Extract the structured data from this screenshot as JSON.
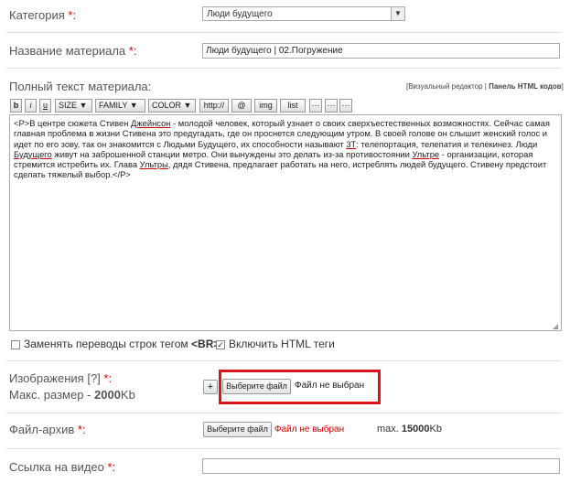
{
  "category": {
    "label": "Категория",
    "required": "*:",
    "value": "Люди будущего"
  },
  "title": {
    "label": "Название материала",
    "required": "*:",
    "value": "Люди будущего | 02.Погружение"
  },
  "fulltext": {
    "label": "Полный текст материала:",
    "editor_modes": {
      "visual": "[Визуальный редактор",
      "sep": " | ",
      "html": "Панель HTML кодов",
      "close": "]"
    },
    "toolbar": {
      "b": "b",
      "i": "i",
      "u": "u",
      "size": "SIZE",
      "family": "FAMILY",
      "color": "COLOR",
      "http": "http://",
      "at": "@",
      "img": "img",
      "list": "list",
      "dots1": "···",
      "dots2": "···",
      "dots3": "···"
    },
    "content": {
      "p1": "<P>В центре сюжета Стивен ",
      "w1": "Джейнсон",
      "p2": " - молодой человек, который узнает о своих сверхъестественных возможностях. Сейчас самая главная проблема в жизни Стивена это предугадать, где он проснется следующим утром. В своей голове он слышит женский голос и идет по его зову, так он знакомится с Людьми Будущего, их способности называют ",
      "w2": "3Т",
      "p3": ": телепортация, телепатия и телекинез. Люди ",
      "w3": "Будущего",
      "p4": " живут на заброшенной станции метро. Они вынуждены это делать из-за противостоянии ",
      "w4": "Ультре",
      "p5": " - организации, которая стремится истребить их. Глава ",
      "w5": "Ультры",
      "p6": ", дядя Стивена, предлагает работать на него, истреблять людей будущего. Стивену предстоит сделать тяжелый выбор.</P>"
    }
  },
  "options": {
    "br_label_pre": "Заменять переводы строк тегом ",
    "br_tag": "<BR>",
    "html_label": "Включить HTML теги"
  },
  "images": {
    "label": "Изображения",
    "help": "[?]",
    "required": "*:",
    "size_pre": "Макс. размер - ",
    "size_val": "2000",
    "size_unit": "Kb",
    "plus": "+",
    "choose": "Выберите файл",
    "no_file": "Файл не выбран"
  },
  "archive": {
    "label": "Файл-архив",
    "required": "*:",
    "choose": "Выберите файл",
    "no_file": "Файл не выбран",
    "max_pre": "max. ",
    "max_val": "15000",
    "max_unit": "Kb"
  },
  "video": {
    "label": "Ссылка на видео",
    "required": "*:"
  },
  "colors": {
    "required": "#dd0000",
    "highlight": "#d9141b"
  }
}
